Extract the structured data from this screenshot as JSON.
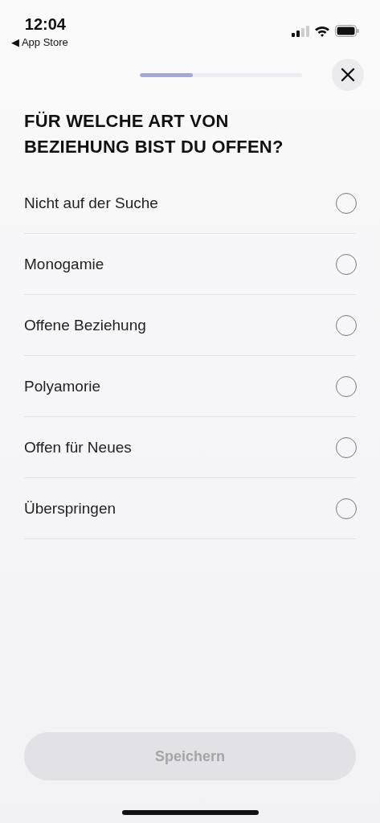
{
  "status_bar": {
    "time": "12:04",
    "back_label": "◀ App Store"
  },
  "progress": {
    "level": 0.33
  },
  "title": "FÜR WELCHE ART VON BEZIEHUNG BIST DU OFFEN?",
  "options": [
    {
      "label": "Nicht auf der Suche",
      "selected": false
    },
    {
      "label": "Monogamie",
      "selected": false
    },
    {
      "label": "Offene Beziehung",
      "selected": false
    },
    {
      "label": "Polyamorie",
      "selected": false
    },
    {
      "label": "Offen für Neues",
      "selected": false
    },
    {
      "label": "Überspringen",
      "selected": false
    }
  ],
  "save_button": {
    "label": "Speichern",
    "disabled": true
  }
}
